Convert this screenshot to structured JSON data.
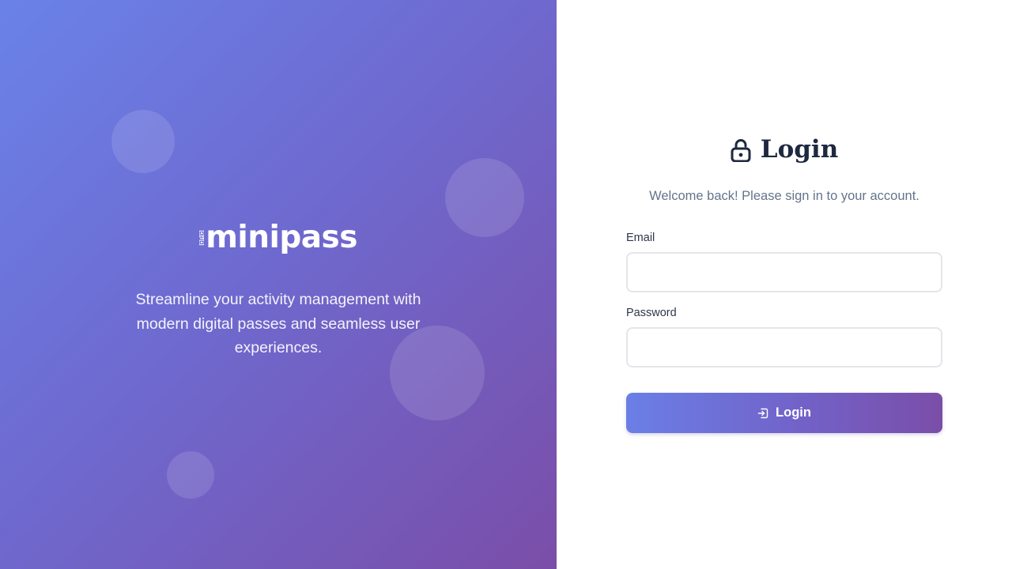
{
  "brand": {
    "logo_text": "minipass",
    "tagline": "Streamline your activity management with modern digital passes and seamless user experiences.",
    "gradient_colors": [
      "#6a82e8",
      "#6e6ad0",
      "#7a4ea8"
    ]
  },
  "login": {
    "title": "Login",
    "title_icon": "lock-icon",
    "subtitle": "Welcome back! Please sign in to your account.",
    "fields": {
      "email": {
        "label": "Email",
        "value": "",
        "placeholder": ""
      },
      "password": {
        "label": "Password",
        "value": "",
        "placeholder": ""
      }
    },
    "submit_button": {
      "label": "Login",
      "icon": "sign-in-icon"
    }
  },
  "colors": {
    "title_text": "#1e2940",
    "subtitle_text": "#64748b",
    "label_text": "#2d3748",
    "input_border": "#e4e6ea",
    "button_gradient": [
      "#6a7fe6",
      "#7a4ea8"
    ]
  }
}
